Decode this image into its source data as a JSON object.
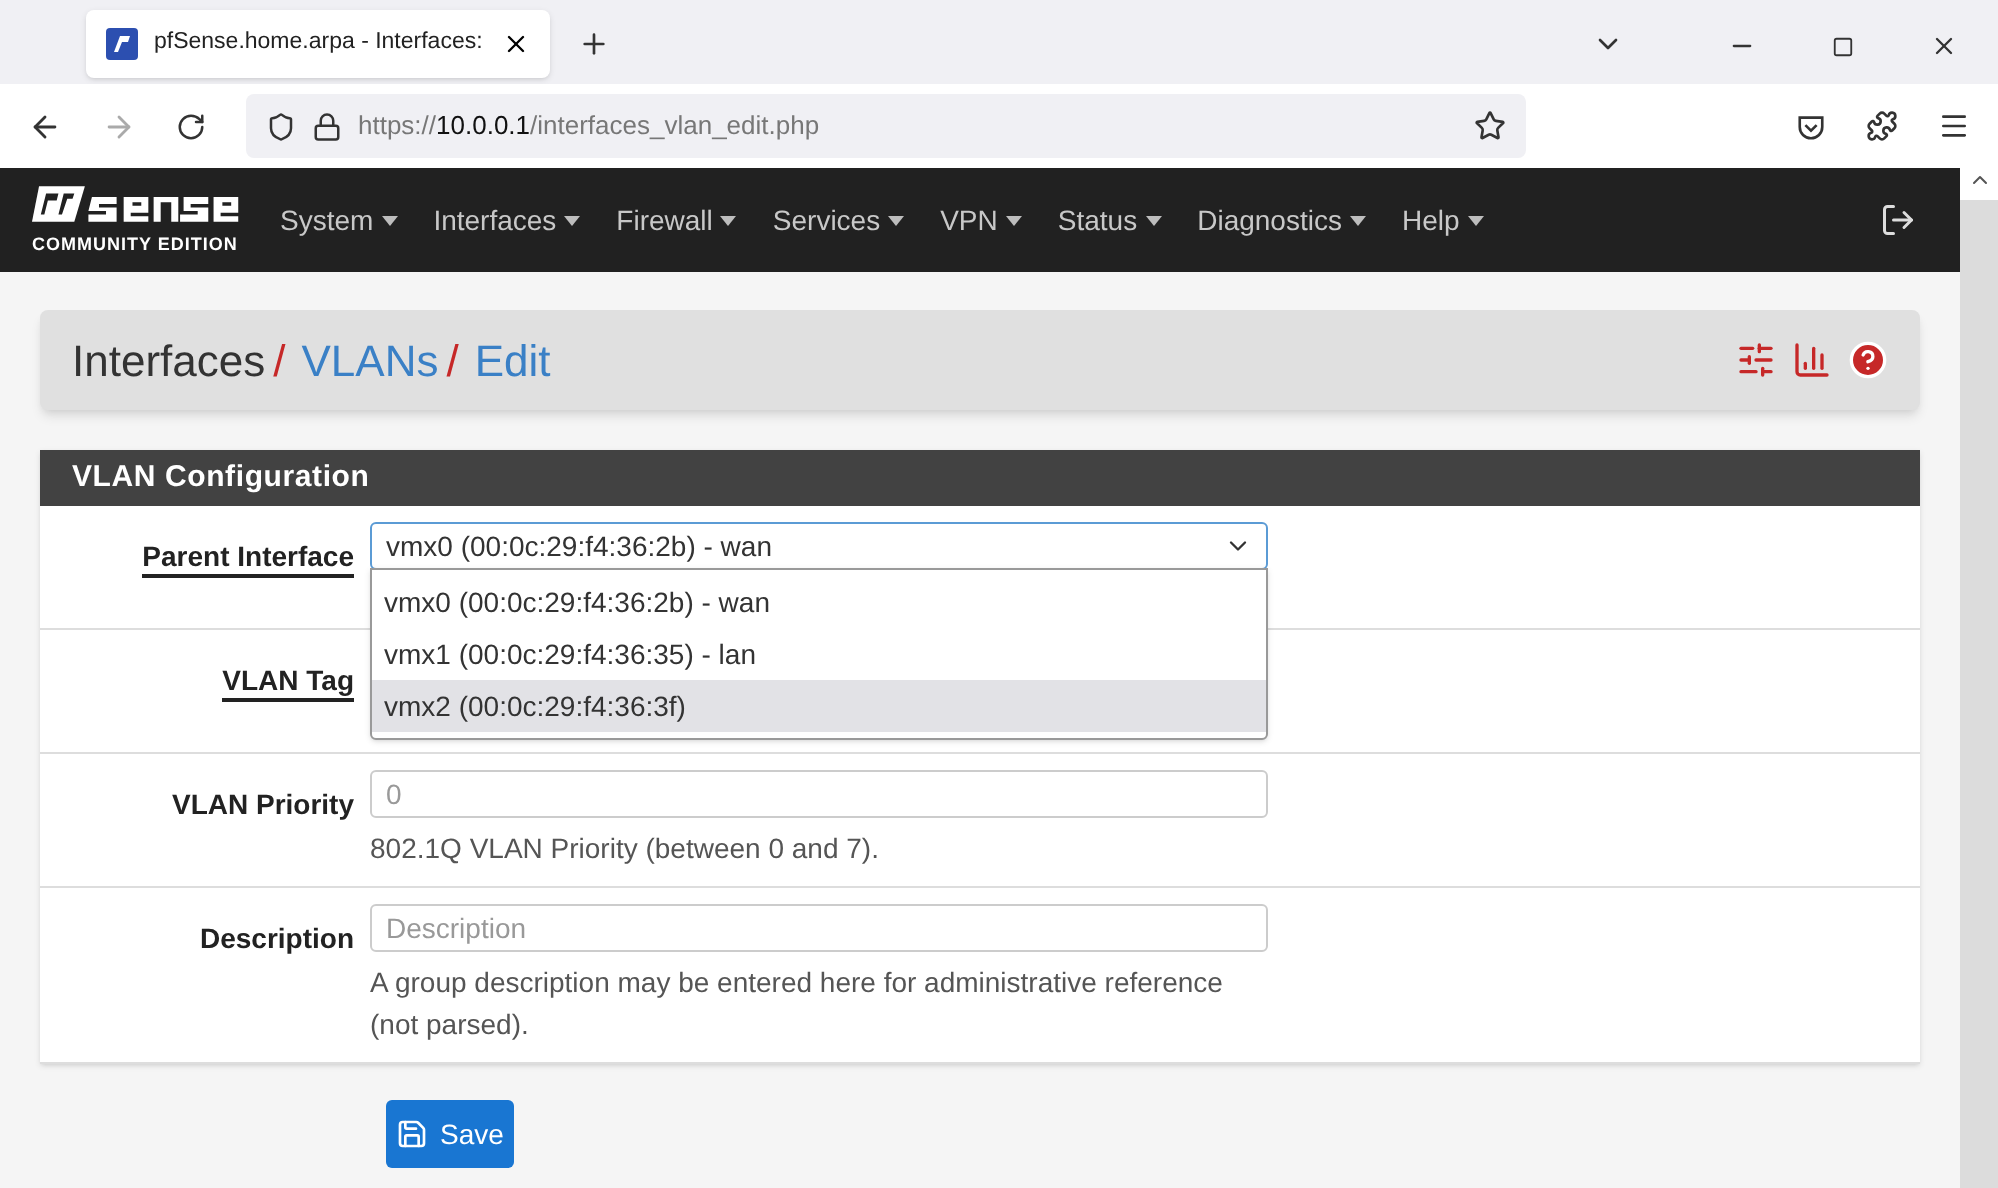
{
  "browser": {
    "tab_title": "pfSense.home.arpa - Interfaces:",
    "url_prefix": "https://",
    "url_host": "10.0.0.1",
    "url_path": "/interfaces_vlan_edit.php"
  },
  "logo": {
    "subtitle": "COMMUNITY EDITION"
  },
  "nav": [
    "System",
    "Interfaces",
    "Firewall",
    "Services",
    "VPN",
    "Status",
    "Diagnostics",
    "Help"
  ],
  "breadcrumb": [
    {
      "label": "Interfaces",
      "link": false,
      "separator": "/"
    },
    {
      "label": "VLANs",
      "link": true,
      "separator": "/"
    },
    {
      "label": "Edit",
      "link": true
    }
  ],
  "panel": {
    "title": "VLAN Configuration"
  },
  "fields": [
    {
      "kind": "select",
      "label": "Parent Interface",
      "required": true,
      "value": "vmx0 (00:0c:29:f4:36:2b) - wan",
      "options": [
        {
          "label": "vmx0 (00:0c:29:f4:36:2b) - wan",
          "highlighted": false
        },
        {
          "label": "vmx1 (00:0c:29:f4:36:35) - lan",
          "highlighted": false
        },
        {
          "label": "vmx2 (00:0c:29:f4:36:3f)",
          "highlighted": true
        }
      ]
    },
    {
      "kind": "covered",
      "label": "VLAN Tag",
      "required": true
    },
    {
      "kind": "text",
      "label": "VLAN Priority",
      "required": false,
      "placeholder": "0",
      "help": "802.1Q VLAN Priority (between 0 and 7)."
    },
    {
      "kind": "text",
      "label": "Description",
      "required": false,
      "placeholder": "Description",
      "help": "A group description may be entered here for administrative reference (not parsed)."
    }
  ],
  "save_button": "Save"
}
